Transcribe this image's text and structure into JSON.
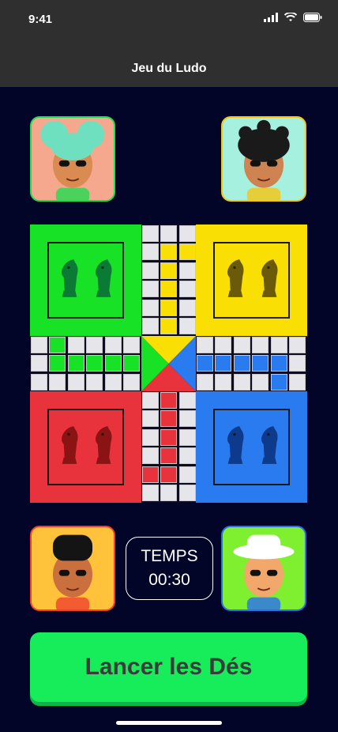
{
  "status_bar": {
    "time": "9:41"
  },
  "header": {
    "title": "Jeu du Ludo"
  },
  "players": [
    {
      "id": "green",
      "color": "#1fdc50",
      "avatar_bg": "#f5a88d",
      "hair": "#6ee0c0",
      "skin": "#d98b52"
    },
    {
      "id": "yellow",
      "color": "#f5c50f",
      "avatar_bg": "#a6f0df",
      "hair": "#1a1a1a",
      "skin": "#cf8350"
    },
    {
      "id": "red",
      "color": "#f0412f",
      "avatar_bg": "#ffc23a",
      "hair": "#141414",
      "skin": "#c9703e"
    },
    {
      "id": "blue",
      "color": "#2b6ff0",
      "avatar_bg": "#7ef030",
      "hair": "#ffffff",
      "skin": "#f1a86a"
    }
  ],
  "board_colors": {
    "green": "#18e226",
    "yellow": "#fadf05",
    "red": "#e8323c",
    "blue": "#2a7af0",
    "cell": "#e6e6ea"
  },
  "timer": {
    "label": "TEMPS",
    "value": "00:30"
  },
  "roll_button": {
    "label": "Lancer les Dés"
  }
}
